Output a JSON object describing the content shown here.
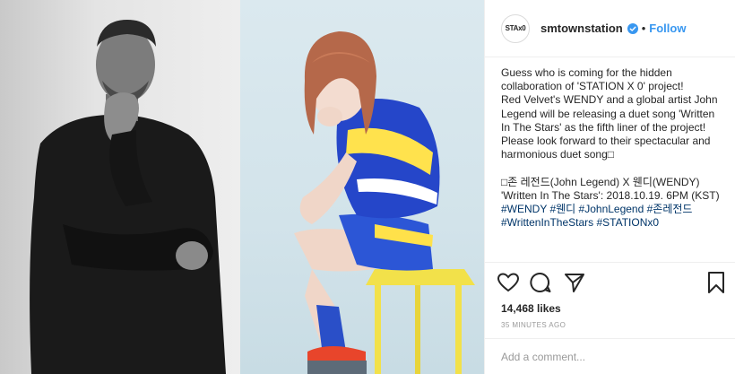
{
  "post": {
    "account": {
      "avatar_text": "STAx0",
      "username": "smtownstation",
      "separator": "•",
      "follow_label": "Follow"
    },
    "caption_text": "Guess who is coming for the hidden collaboration of 'STATION X 0' project!\nRed Velvet's WENDY and a global artist John Legend will be releasing a duet song 'Written In The Stars' as the fifth liner of the project!\nPlease look forward to their spectacular and harmonious duet song□\n\n□존 레전드(John Legend) X 웬디(WENDY)\n'Written In The Stars': 2018.10.19. 6PM (KST)",
    "hashtags": "#WENDY #웬디 #JohnLegend #존레전드 #WrittenInTheStars #STATIONx0",
    "likes": "14,468 likes",
    "time_ago": "35 MINUTES AGO",
    "comment_placeholder": "Add a comment..."
  },
  "icons": {
    "like": "heart-icon",
    "comment": "speech-bubble-icon",
    "share": "paper-plane-icon",
    "save": "bookmark-icon",
    "verified": "verified-badge-icon"
  },
  "colors": {
    "link": "#3897f0",
    "hashtag": "#003569",
    "muted": "#999999",
    "border": "#efefef",
    "text": "#262626"
  }
}
